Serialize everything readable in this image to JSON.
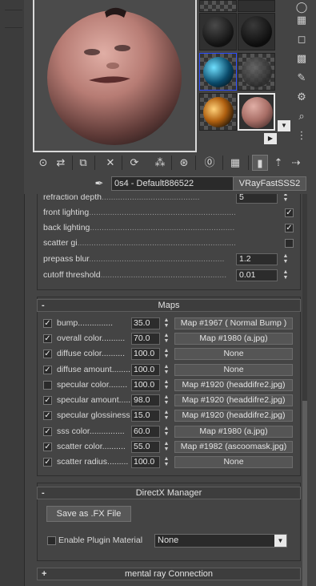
{
  "material": {
    "name": "0s4 - Default886522",
    "type_label": "VRayFastSSS2"
  },
  "toolbar": {
    "icons": [
      "get-material-icon",
      "put-to-scene-icon",
      "assign-material-icon",
      "reset-map-icon",
      "make-copy-icon",
      "make-unique-icon",
      "put-to-library-icon",
      "material-id-icon",
      "show-map-icon",
      "show-end-result-icon",
      "go-to-parent-icon",
      "go-forward-icon"
    ]
  },
  "advanced_params": {
    "refraction_depth": {
      "label": "refraction depth",
      "value": "5"
    },
    "front_lighting": {
      "label": "front lighting",
      "checked": true
    },
    "back_lighting": {
      "label": "back lighting",
      "checked": true
    },
    "scatter_gi": {
      "label": "scatter gi",
      "checked": false
    },
    "prepass_blur": {
      "label": "prepass blur",
      "value": "1.2"
    },
    "cutoff_threshold": {
      "label": "cutoff threshold",
      "value": "0.01"
    }
  },
  "maps": {
    "title": "Maps",
    "toggle": "-",
    "rows": [
      {
        "label": "bump",
        "checked": true,
        "amount": "35.0",
        "map": "Map #1967  ( Normal Bump )"
      },
      {
        "label": "overall color",
        "checked": true,
        "amount": "70.0",
        "map": "Map #1980 (a.jpg)"
      },
      {
        "label": "diffuse color",
        "checked": true,
        "amount": "100.0",
        "map": "None"
      },
      {
        "label": "diffuse amount",
        "checked": true,
        "amount": "100.0",
        "map": "None"
      },
      {
        "label": "specular color",
        "checked": false,
        "amount": "100.0",
        "map": "Map #1920 (headdifre2.jpg)"
      },
      {
        "label": "specular amount",
        "checked": true,
        "amount": "98.0",
        "map": "Map #1920 (headdifre2.jpg)"
      },
      {
        "label": "specular glossiness",
        "checked": true,
        "amount": "15.0",
        "map": "Map #1920 (headdifre2.jpg)"
      },
      {
        "label": "sss color",
        "checked": true,
        "amount": "60.0",
        "map": "Map #1980 (a.jpg)"
      },
      {
        "label": "scatter color",
        "checked": true,
        "amount": "55.0",
        "map": "Map #1982 (ascoomask.jpg)"
      },
      {
        "label": "scatter radius",
        "checked": true,
        "amount": "100.0",
        "map": "None"
      }
    ]
  },
  "directx": {
    "title": "DirectX Manager",
    "toggle": "-",
    "save_fx_label": "Save as .FX File",
    "enable_plugin_label": "Enable Plugin Material",
    "enable_plugin_checked": false,
    "plugin_selected": "None"
  },
  "mental_ray": {
    "title": "mental ray Connection",
    "toggle": "+"
  },
  "colors": {
    "background": "#444444",
    "skin": "#c98f86",
    "selected_border": "#e8e8e8"
  }
}
